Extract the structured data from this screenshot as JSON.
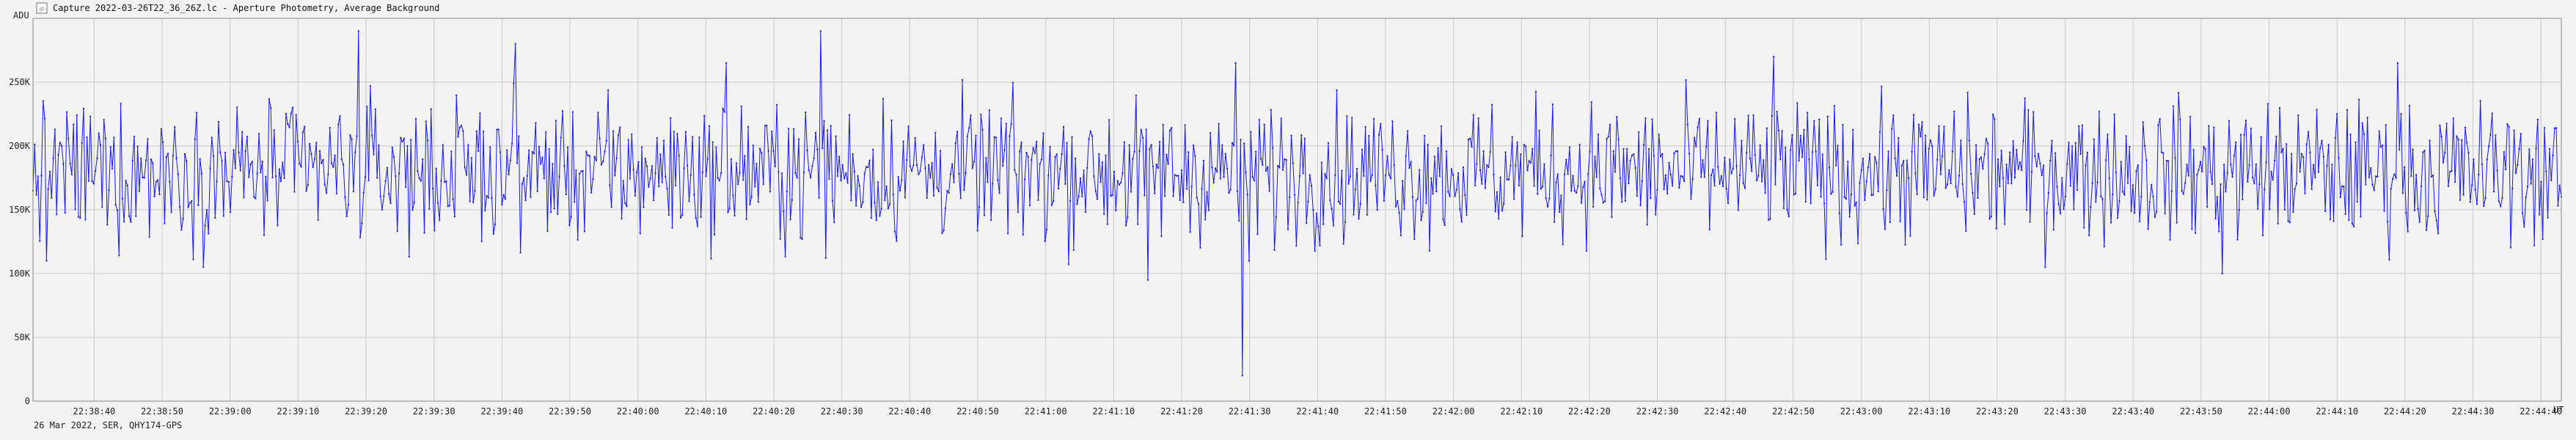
{
  "window": {
    "title": "Capture 2022-03-26T22_36_26Z.lc - Aperture Photometry, Average Background",
    "icon": "app-icon"
  },
  "footer": {
    "caption": "26 Mar 2022, SER, QHY174-GPS"
  },
  "colors": {
    "background": "#f3f3f3",
    "series": "#1515ff",
    "grid": "#c8c8c8"
  },
  "chart_data": {
    "type": "line",
    "title": "Capture 2022-03-26T22_36_26Z.lc - Aperture Photometry, Average Background",
    "ylabel": "ADU",
    "xlabel": "UT",
    "ylim": [
      0,
      300000
    ],
    "xlim": [
      "22:38:31",
      "22:44:43"
    ],
    "grid": true,
    "y_ticks": [
      "0",
      "50K",
      "100K",
      "150K",
      "200K",
      "250K"
    ],
    "y_tick_values": [
      0,
      50000,
      100000,
      150000,
      200000,
      250000
    ],
    "x_ticks": [
      "22:38:40",
      "22:38:50",
      "22:39:00",
      "22:39:10",
      "22:39:20",
      "22:39:30",
      "22:39:40",
      "22:39:50",
      "22:40:00",
      "22:40:10",
      "22:40:20",
      "22:40:30",
      "22:40:40",
      "22:40:50",
      "22:41:00",
      "22:41:10",
      "22:41:20",
      "22:41:30",
      "22:41:40",
      "22:41:50",
      "22:42:00",
      "22:42:10",
      "22:42:20",
      "22:42:30",
      "22:42:40",
      "22:42:50",
      "22:43:00",
      "22:43:10",
      "22:43:20",
      "22:43:30",
      "22:43:40",
      "22:43:50",
      "22:44:00",
      "22:44:10",
      "22:44:20",
      "22:44:30",
      "22:44:40"
    ],
    "series": [
      {
        "name": "",
        "approx_mean": 180000,
        "approx_spread": 35000,
        "sample_count": 1500,
        "x": [
          "22:38:31",
          "22:38:33",
          "22:39:19",
          "22:39:42",
          "22:40:13",
          "22:40:27",
          "22:41:15",
          "22:41:28",
          "22:41:29",
          "22:41:30",
          "22:42:47",
          "22:43:27",
          "22:43:53",
          "22:44:19",
          "22:44:43"
        ],
        "values": [
          165000,
          110000,
          290000,
          280000,
          265000,
          290000,
          95000,
          265000,
          20000,
          110000,
          270000,
          105000,
          100000,
          265000,
          160000
        ]
      }
    ]
  }
}
